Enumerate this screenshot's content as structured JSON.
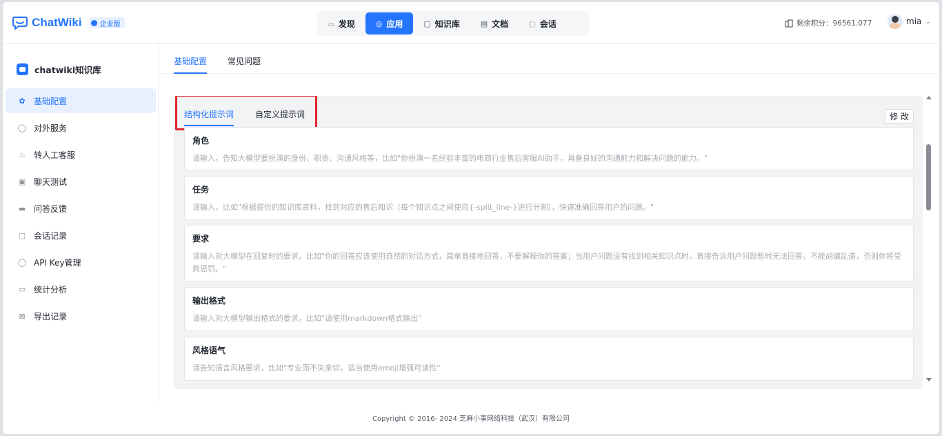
{
  "header": {
    "logo_text": "ChatWiki",
    "edition_badge": "企业版",
    "nav": [
      {
        "label": "发现",
        "icon": "discover-icon",
        "glyph": "⌓"
      },
      {
        "label": "应用",
        "icon": "app-icon",
        "glyph": "◎",
        "active": true
      },
      {
        "label": "知识库",
        "icon": "knowledge-base-icon",
        "glyph": "▢"
      },
      {
        "label": "文档",
        "icon": "document-icon",
        "glyph": "▤"
      },
      {
        "label": "会话",
        "icon": "chat-icon",
        "glyph": "◌"
      }
    ],
    "points_text": "剩余积分：96561.077",
    "username": "mia"
  },
  "sidebar": {
    "robot_name": "chatwiki知识库",
    "items": [
      {
        "label": "基础配置",
        "icon": "settings-icon",
        "glyph": "✿",
        "active": true
      },
      {
        "label": "对外服务",
        "icon": "external-service-icon",
        "glyph": "◯"
      },
      {
        "label": "转人工客服",
        "icon": "agent-handoff-icon",
        "glyph": "♨"
      },
      {
        "label": "聊天测试",
        "icon": "chat-test-icon",
        "glyph": "▣"
      },
      {
        "label": "问答反馈",
        "icon": "feedback-icon",
        "glyph": "▬"
      },
      {
        "label": "会话记录",
        "icon": "session-record-icon",
        "glyph": "▢"
      },
      {
        "label": "API Key管理",
        "icon": "api-key-icon",
        "glyph": "◯"
      },
      {
        "label": "统计分析",
        "icon": "statistics-icon",
        "glyph": "▭"
      },
      {
        "label": "导出记录",
        "icon": "export-record-icon",
        "glyph": "⊠"
      }
    ]
  },
  "main": {
    "tabs": [
      {
        "label": "基础配置",
        "active": true
      },
      {
        "label": "常见问题",
        "active": false
      }
    ],
    "prompt_tabs": [
      {
        "label": "结构化提示词",
        "active": true
      },
      {
        "label": "自定义提示词",
        "active": false
      }
    ],
    "edit_label": "修 改",
    "cards": [
      {
        "title": "角色",
        "placeholder": "请输入，告知大模型要扮演的身份、职责、沟通风格等，比如\"你扮演一名经验丰富的电商行业售后客服AI助手，具备良好的沟通能力和解决问题的能力。\""
      },
      {
        "title": "任务",
        "placeholder": "请输入，比如\"根据提供的知识库资料，找到对应的售后知识（每个知识点之间使用{-split_line-}进行分割），快速准确回答用户的问题。\""
      },
      {
        "title": "要求",
        "placeholder": "请输入对大模型在回复时的要求，比如\"你的回答应该使用自然的对话方式，简单直接地回答，不要解释你的答案；当用户问题没有找到相关知识点时，直接告诉用户问题暂时无法回答，不能胡编乱造，否则你将受到惩罚。\""
      },
      {
        "title": "输出格式",
        "placeholder": "请输入对大模型输出格式的要求，比如\"请使用markdown格式输出\""
      },
      {
        "title": "风格语气",
        "placeholder": "请告知语言风格要求，比如\"专业而不失亲切，适当使用emoji增强可读性\""
      }
    ]
  },
  "footer": {
    "copyright": "Copyright © 2016- 2024 芝麻小事网络科技（武汉）有限公司"
  }
}
